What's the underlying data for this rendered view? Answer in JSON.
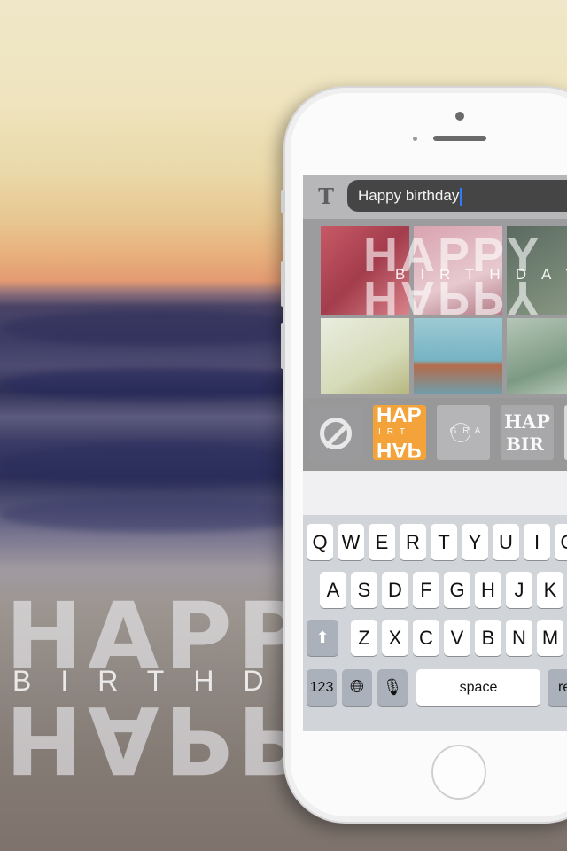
{
  "watermark": {
    "top_word": "HAPPY",
    "middle_word": "BIRTHD",
    "bottom_word": "HAPPY"
  },
  "app": {
    "text_button_label": "T",
    "text_field_value": "Happy birthday",
    "preview": {
      "top_word": "HAPPY",
      "middle_word": "BIRTHDAY",
      "bottom_word": "HAPPY"
    },
    "styles": [
      {
        "name": "none",
        "label": ""
      },
      {
        "name": "happy-birthday-orange",
        "label_top": "HAP",
        "label_mid": "IRT",
        "label_bottom": "HAP"
      },
      {
        "name": "gra-circles",
        "label": "G R A"
      },
      {
        "name": "hap-bir-serif",
        "label_top": "HAP",
        "label_bottom": "BIR"
      }
    ],
    "nav": {
      "back_icon": "chevron-left-icon",
      "forward_icon": "chevron-right-icon"
    }
  },
  "keyboard": {
    "row1": [
      "Q",
      "W",
      "E",
      "R",
      "T",
      "Y",
      "U",
      "I",
      "O"
    ],
    "row2": [
      "A",
      "S",
      "D",
      "F",
      "G",
      "H",
      "J",
      "K"
    ],
    "row3": [
      "Z",
      "X",
      "C",
      "V",
      "B",
      "N",
      "M"
    ],
    "numbers_label": "123",
    "space_label": "space",
    "return_label": "return",
    "globe_icon": "globe-icon",
    "mic_icon": "microphone-icon",
    "shift_icon": "shift-icon"
  }
}
